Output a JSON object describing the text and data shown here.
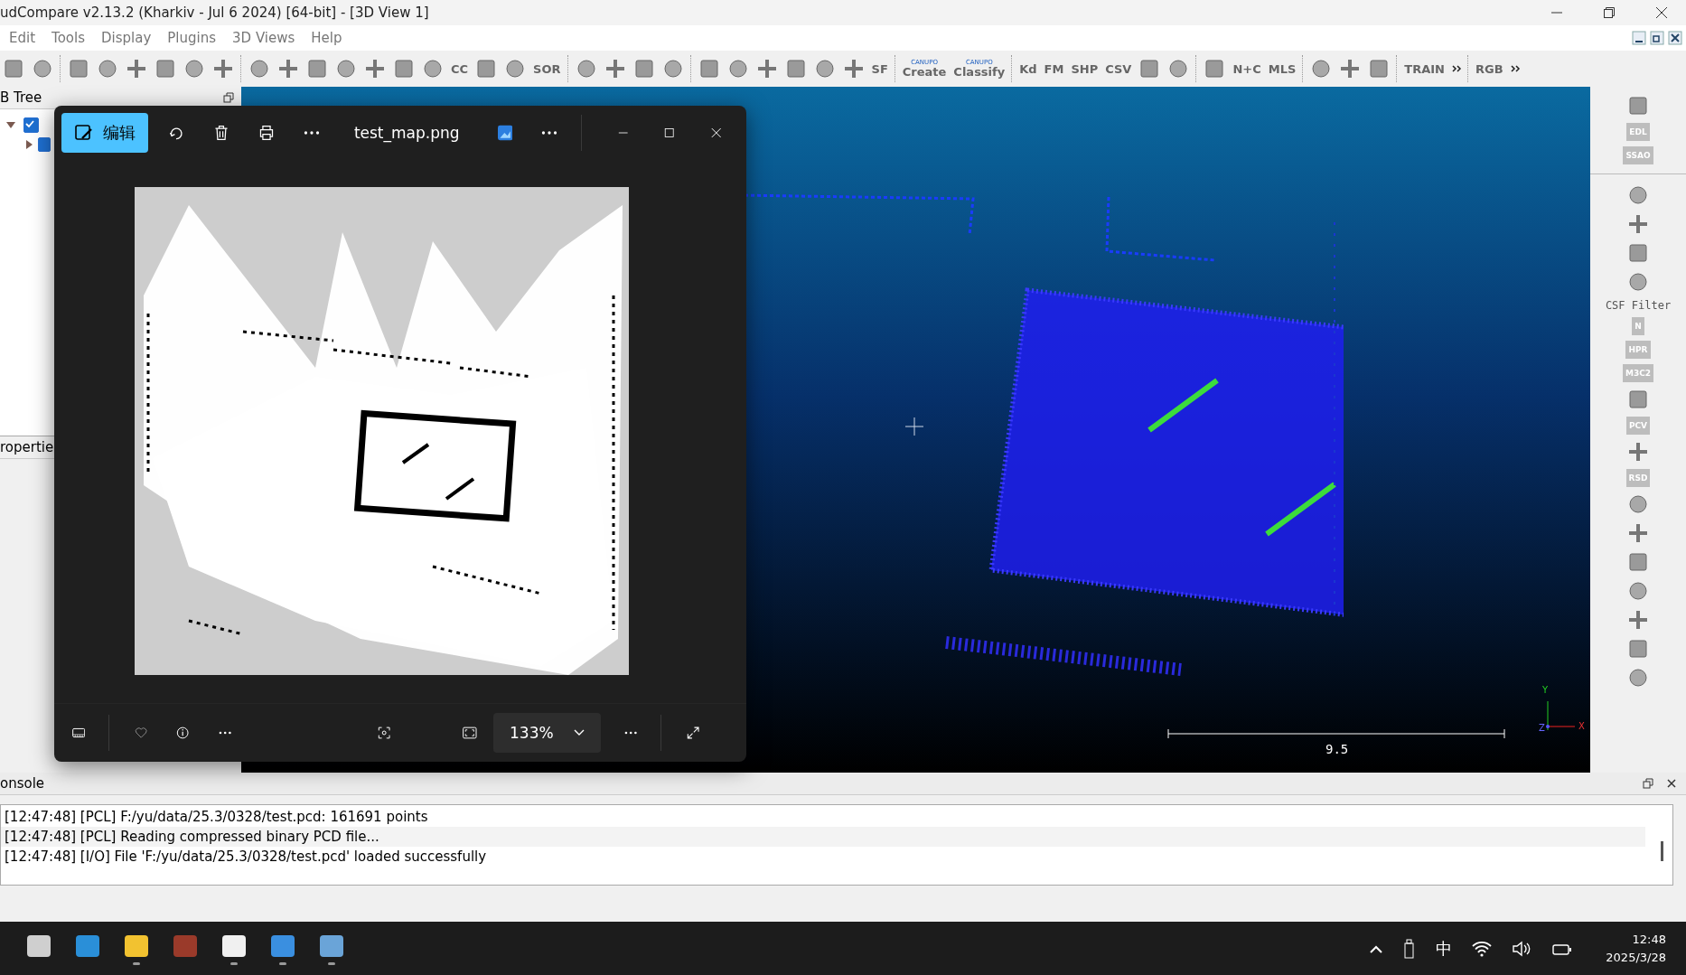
{
  "window": {
    "title": "udCompare v2.13.2 (Kharkiv - Jul  6 2024) [64-bit] - [3D View 1]"
  },
  "menu": [
    "Edit",
    "Tools",
    "Display",
    "Plugins",
    "3D Views",
    "Help"
  ],
  "toolbar": [
    {
      "kind": "icon"
    },
    {
      "kind": "icon"
    },
    {
      "kind": "sep"
    },
    {
      "kind": "icon"
    },
    {
      "kind": "icon"
    },
    {
      "kind": "icon"
    },
    {
      "kind": "icon"
    },
    {
      "kind": "icon"
    },
    {
      "kind": "icon"
    },
    {
      "kind": "sep"
    },
    {
      "kind": "icon"
    },
    {
      "kind": "icon"
    },
    {
      "kind": "icon"
    },
    {
      "kind": "icon"
    },
    {
      "kind": "icon"
    },
    {
      "kind": "icon"
    },
    {
      "kind": "icon"
    },
    {
      "kind": "text",
      "label": "CC"
    },
    {
      "kind": "icon"
    },
    {
      "kind": "icon"
    },
    {
      "kind": "text",
      "label": "SOR"
    },
    {
      "kind": "sep"
    },
    {
      "kind": "icon"
    },
    {
      "kind": "icon"
    },
    {
      "kind": "icon"
    },
    {
      "kind": "icon"
    },
    {
      "kind": "sep"
    },
    {
      "kind": "icon"
    },
    {
      "kind": "icon"
    },
    {
      "kind": "icon"
    },
    {
      "kind": "icon"
    },
    {
      "kind": "icon"
    },
    {
      "kind": "icon"
    },
    {
      "kind": "text",
      "label": "SF"
    },
    {
      "kind": "sep"
    },
    {
      "kind": "text",
      "caption": "CANUPO",
      "label": "Create"
    },
    {
      "kind": "text",
      "caption": "CANUPO",
      "label": "Classify"
    },
    {
      "kind": "sep"
    },
    {
      "kind": "text",
      "label": "Kd"
    },
    {
      "kind": "text",
      "label": "FM"
    },
    {
      "kind": "text",
      "label": "SHP"
    },
    {
      "kind": "text",
      "label": "CSV"
    },
    {
      "kind": "icon"
    },
    {
      "kind": "icon"
    },
    {
      "kind": "sep"
    },
    {
      "kind": "icon"
    },
    {
      "kind": "text",
      "label": "N+C"
    },
    {
      "kind": "text",
      "label": "MLS"
    },
    {
      "kind": "sep"
    },
    {
      "kind": "icon"
    },
    {
      "kind": "icon"
    },
    {
      "kind": "icon"
    },
    {
      "kind": "sep"
    },
    {
      "kind": "text",
      "label": "TRAIN"
    },
    {
      "kind": "more"
    },
    {
      "kind": "sep"
    },
    {
      "kind": "text",
      "label": "RGB"
    },
    {
      "kind": "more"
    }
  ],
  "db_tree": {
    "title": "B Tree",
    "items": [
      {
        "expanded": true,
        "checked": true,
        "children": [
          {
            "expanded": false,
            "checked": true
          }
        ]
      }
    ]
  },
  "properties": {
    "title": "ropertie"
  },
  "view_3d": {
    "scale_label": "9.5",
    "axes": [
      "Y",
      "Z",
      "X"
    ]
  },
  "viewer": {
    "edit_label": "编辑",
    "filename": "test_map.png",
    "zoom": "133%"
  },
  "right_toolbar": [
    {
      "kind": "icon"
    },
    {
      "kind": "text",
      "label": "EDL"
    },
    {
      "kind": "text",
      "label": "SSAO"
    },
    {
      "kind": "sep"
    },
    {
      "kind": "icon"
    },
    {
      "kind": "icon"
    },
    {
      "kind": "icon"
    },
    {
      "kind": "icon"
    },
    {
      "kind": "caption",
      "label": "CSF Filter"
    },
    {
      "kind": "text",
      "label": "N"
    },
    {
      "kind": "text",
      "label": "HPR"
    },
    {
      "kind": "text",
      "label": "M3C2"
    },
    {
      "kind": "icon"
    },
    {
      "kind": "text",
      "label": "PCV"
    },
    {
      "kind": "icon"
    },
    {
      "kind": "text",
      "label": "RSD"
    },
    {
      "kind": "icon"
    },
    {
      "kind": "icon"
    },
    {
      "kind": "icon"
    },
    {
      "kind": "icon"
    },
    {
      "kind": "icon"
    },
    {
      "kind": "icon"
    },
    {
      "kind": "icon"
    }
  ],
  "console": {
    "title": "onsole",
    "lines": [
      "[12:47:48] [PCL] F:/yu/data/25.3/0328/test.pcd: 161691 points",
      "[12:47:48] [PCL] Reading compressed binary PCD file...",
      "[12:47:48] [I/O] File 'F:/yu/data/25.3/0328/test.pcd' loaded successfully"
    ]
  },
  "taskbar": {
    "apps": [
      {
        "running": false
      },
      {
        "running": false
      },
      {
        "running": true
      },
      {
        "running": false
      },
      {
        "running": true
      },
      {
        "running": true
      },
      {
        "running": true
      }
    ],
    "ime": "中",
    "time": "12:48",
    "date": "2025/3/28"
  }
}
